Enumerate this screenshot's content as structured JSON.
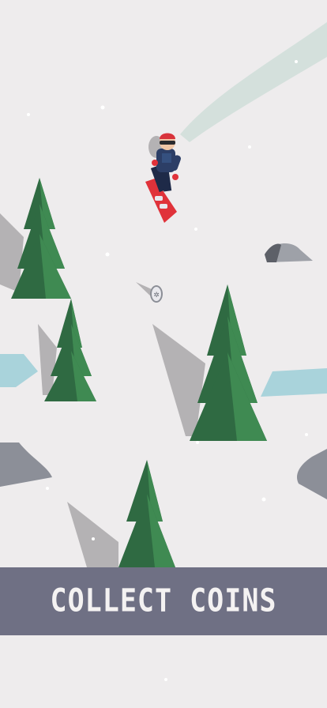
{
  "banner": {
    "text": "COLLECT COINS"
  },
  "colors": {
    "snow": "#eeeced",
    "tree_dark": "#2f6a42",
    "tree_light": "#3f8a52",
    "shadow": "#b4b2b4",
    "ice": "#a9d3db",
    "rock": "#8c8f98",
    "banner_bg": "#6f7084",
    "board": "#e0323a",
    "jacket": "#2c3e66",
    "helmet": "#d8333b"
  },
  "icons": {
    "coin": "coin-icon",
    "player": "snowboarder",
    "tree": "pine-tree",
    "rock": "rock"
  }
}
